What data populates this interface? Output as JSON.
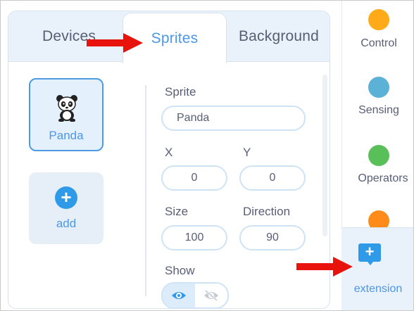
{
  "tabs": {
    "devices": "Devices",
    "sprites": "Sprites",
    "background": "Background"
  },
  "sprite_list": {
    "selected_sprite": "Panda",
    "add_label": "add"
  },
  "sprite_props": {
    "sprite_label": "Sprite",
    "sprite_name": "Panda",
    "x_label": "X",
    "x_value": "0",
    "y_label": "Y",
    "y_value": "0",
    "size_label": "Size",
    "size_value": "100",
    "direction_label": "Direction",
    "direction_value": "90",
    "show_label": "Show"
  },
  "palette": {
    "categories": [
      {
        "label": "Control",
        "color": "#ffab19"
      },
      {
        "label": "Sensing",
        "color": "#5cb1d6"
      },
      {
        "label": "Operators",
        "color": "#59c059"
      },
      {
        "label": "",
        "color": "#ff8c1a"
      }
    ],
    "extension_label": "extension"
  },
  "colors": {
    "accent": "#4c97e8",
    "annotation_arrow": "#e8130c"
  }
}
